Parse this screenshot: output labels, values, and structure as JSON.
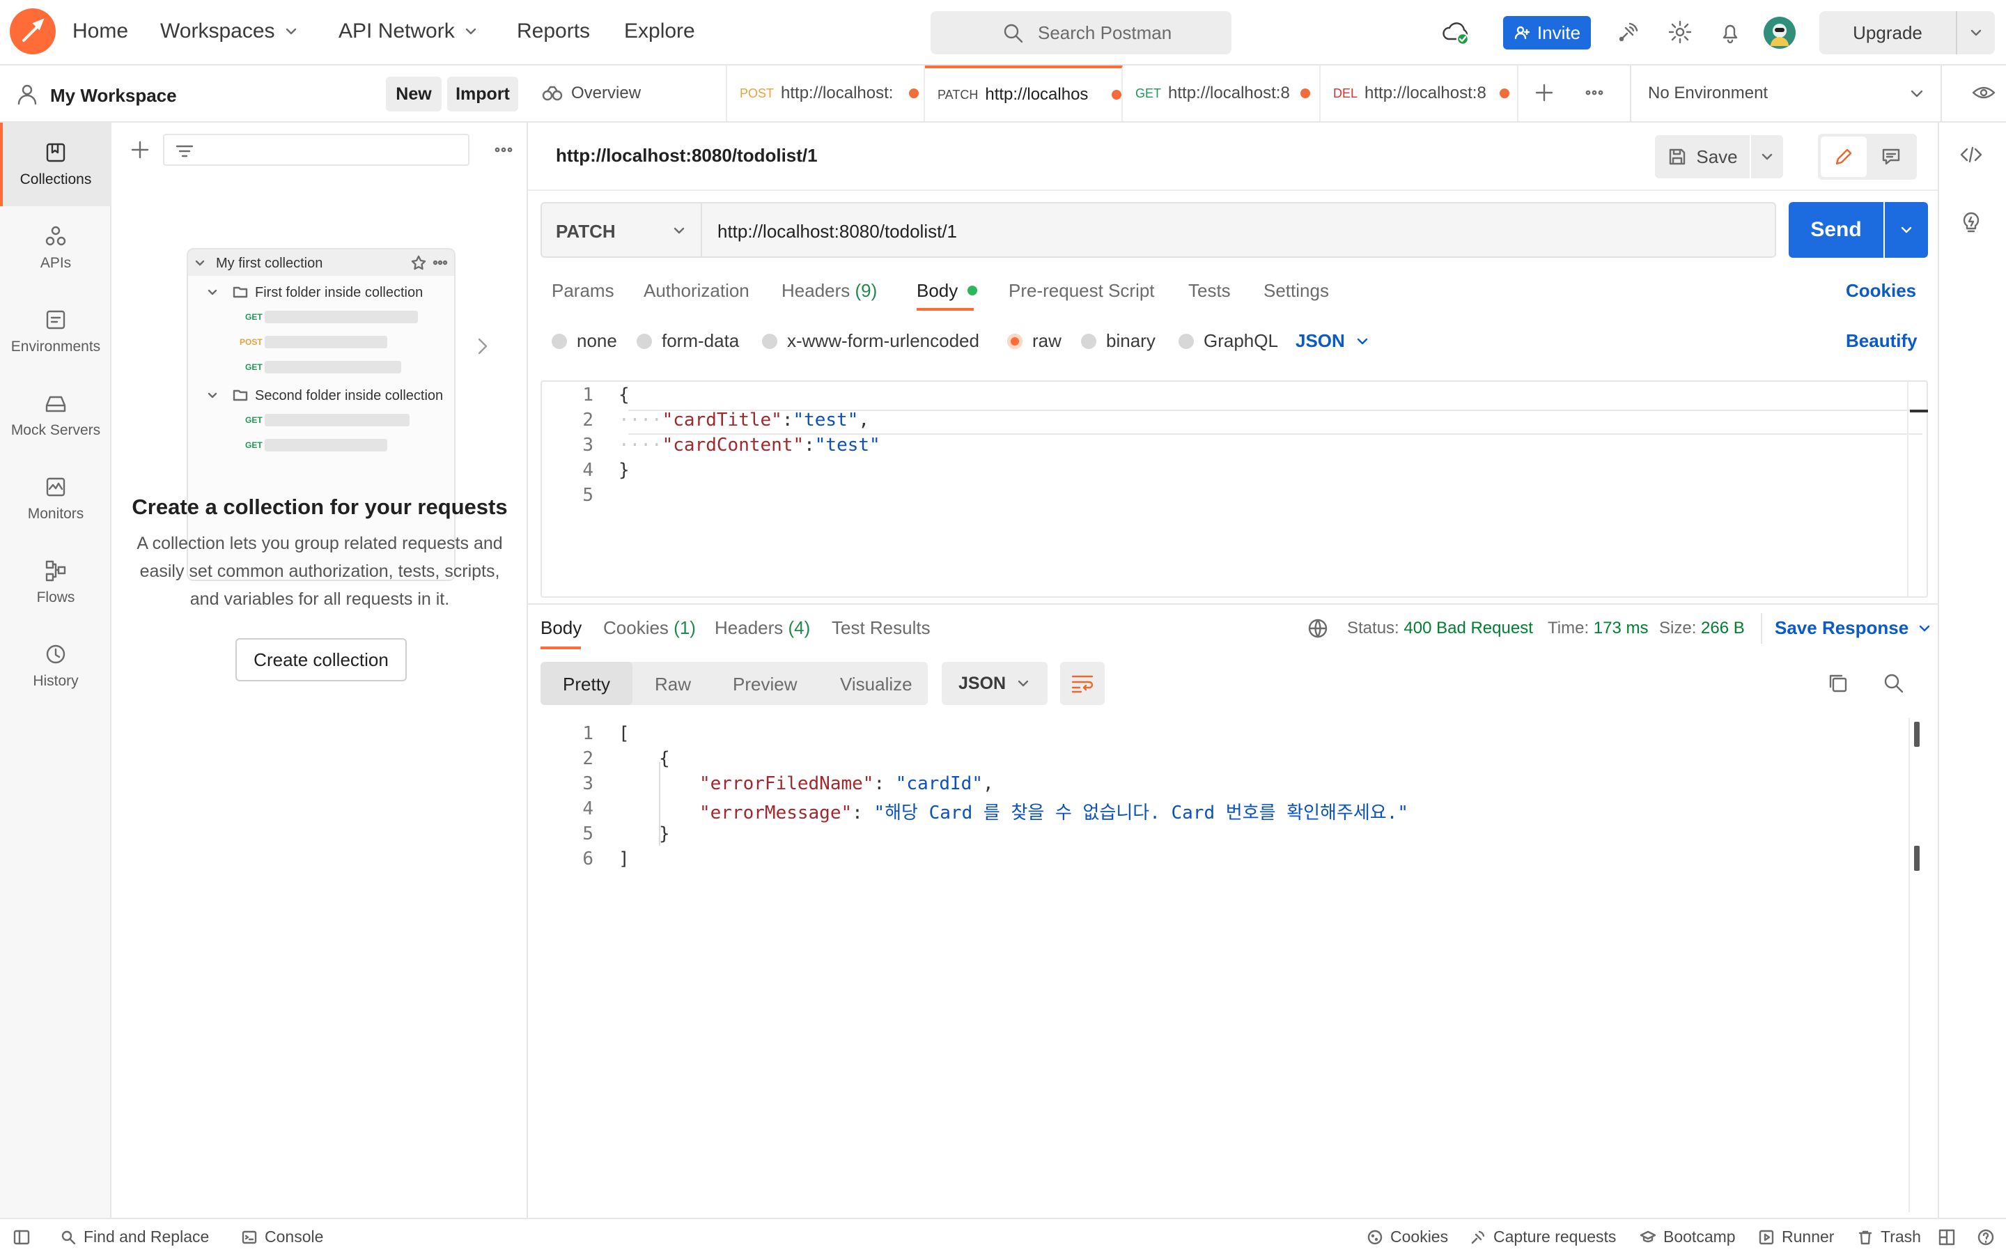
{
  "nav": {
    "home": "Home",
    "workspaces": "Workspaces",
    "api_network": "API Network",
    "reports": "Reports",
    "explore": "Explore",
    "search_placeholder": "Search Postman",
    "invite": "Invite",
    "upgrade": "Upgrade"
  },
  "workspace": {
    "name": "My Workspace",
    "new": "New",
    "import": "Import"
  },
  "rail": [
    {
      "label": "Collections",
      "icon": "collections-icon"
    },
    {
      "label": "APIs",
      "icon": "apis-icon"
    },
    {
      "label": "Environments",
      "icon": "environments-icon"
    },
    {
      "label": "Mock Servers",
      "icon": "mock-servers-icon"
    },
    {
      "label": "Monitors",
      "icon": "monitors-icon"
    },
    {
      "label": "Flows",
      "icon": "flows-icon"
    },
    {
      "label": "History",
      "icon": "history-icon"
    }
  ],
  "empty_state": {
    "preview_collection": "My first collection",
    "preview_folder1": "First folder inside collection",
    "preview_folder2": "Second folder inside collection",
    "m_get": "GET",
    "m_post": "POST",
    "title": "Create a collection for your requests",
    "desc_line1": "A collection lets you group related requests and",
    "desc_line2": "easily set common authorization, tests, scripts,",
    "desc_line3": "and variables for all requests in it.",
    "button": "Create collection"
  },
  "tabs": {
    "overview": "Overview",
    "t1_method": "POST",
    "t1_url": "http://localhost:",
    "t2_method": "PATCH",
    "t2_url": "http://localhos",
    "t3_method": "GET",
    "t3_url": "http://localhost:8",
    "t4_method": "DEL",
    "t4_url": "http://localhost:8",
    "environment": "No Environment"
  },
  "request": {
    "title": "http://localhost:8080/todolist/1",
    "save": "Save",
    "method": "PATCH",
    "url": "http://localhost:8080/todolist/1",
    "send": "Send",
    "subtabs": {
      "params": "Params",
      "authorization": "Authorization",
      "headers": "Headers",
      "headers_count": "(9)",
      "body": "Body",
      "prerequest": "Pre-request Script",
      "tests": "Tests",
      "settings": "Settings",
      "cookies": "Cookies"
    },
    "body_types": {
      "none": "none",
      "form_data": "form-data",
      "urlencoded": "x-www-form-urlencoded",
      "raw": "raw",
      "binary": "binary",
      "graphql": "GraphQL",
      "language": "JSON",
      "beautify": "Beautify"
    },
    "code": {
      "l1": "{",
      "l2_key": "\"cardTitle\"",
      "l2_val": "\"test\"",
      "l3_key": "\"cardContent\"",
      "l3_val": "\"test\"",
      "l4": "}"
    }
  },
  "response": {
    "tabs": {
      "body": "Body",
      "cookies": "Cookies",
      "cookies_count": "(1)",
      "headers": "Headers",
      "headers_count": "(4)",
      "test_results": "Test Results"
    },
    "status_label": "Status:",
    "status_value": "400 Bad Request",
    "time_label": "Time:",
    "time_value": "173 ms",
    "size_label": "Size:",
    "size_value": "266 B",
    "save_response": "Save Response",
    "views": {
      "pretty": "Pretty",
      "raw": "Raw",
      "preview": "Preview",
      "visualize": "Visualize",
      "format": "JSON"
    },
    "code": {
      "l1": "[",
      "l2": "{",
      "l3_key": "\"errorFiledName\"",
      "l3_val": "\"cardId\"",
      "l4_key": "\"errorMessage\"",
      "l4_val": "\"해당 Card 를 찾을 수 없습니다. Card 번호를 확인해주세요.\"",
      "l5": "}",
      "l6": "]"
    }
  },
  "statusbar": {
    "find_replace": "Find and Replace",
    "console": "Console",
    "cookies": "Cookies",
    "capture": "Capture requests",
    "bootcamp": "Bootcamp",
    "runner": "Runner",
    "trash": "Trash"
  },
  "colors": {
    "brand_orange": "#ff6c37",
    "send_blue": "#1c6ce0",
    "status_green": "#007f31",
    "link_blue": "#0b5ac7"
  }
}
